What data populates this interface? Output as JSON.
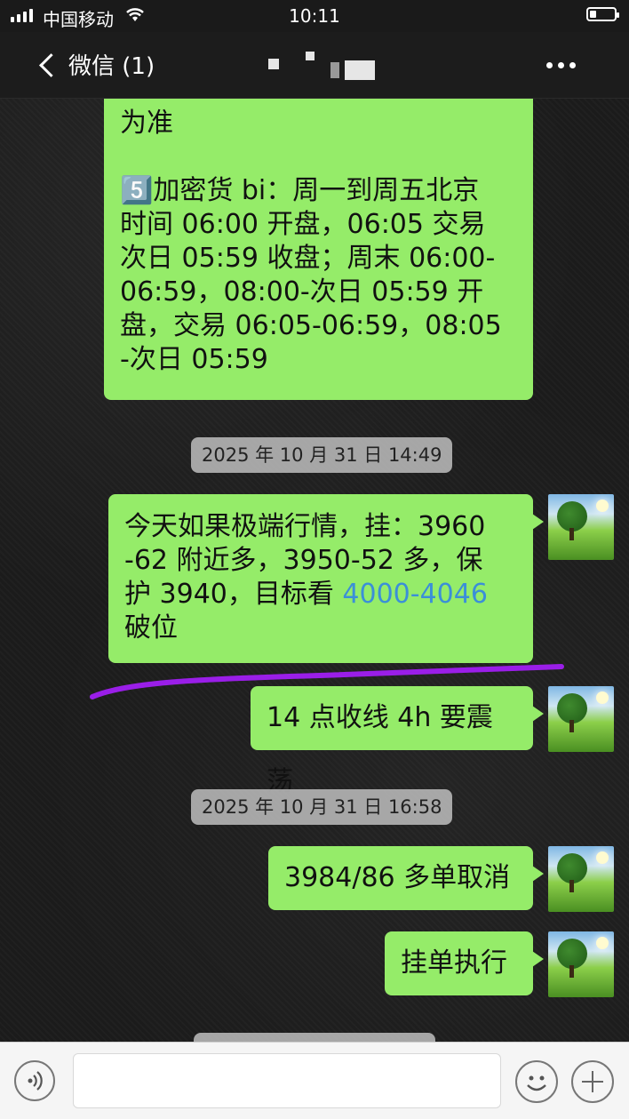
{
  "status_bar": {
    "carrier": "中国移动",
    "time": "10:11"
  },
  "header": {
    "back_label": "微信 (1)"
  },
  "messages": [
    {
      "type": "text",
      "lines": [
        "为准",
        "",
        "5️⃣加密货 bi：周一到周五北京",
        "时间 06:00 开盘，06:05 交易",
        "次日 05:59 收盘；周末 06:00-",
        "06:59，08:00-次日 05:59 开",
        "盘，交易 06:05-06:59，08:05",
        "-次日 05:59"
      ]
    },
    {
      "type": "timestamp",
      "text": "2025 年 10 月 31 日 14:49"
    },
    {
      "type": "text",
      "line1": "今天如果极端行情，挂：3960",
      "line2": "-62 附近多，3950-52 多，保",
      "line3_prefix": "护 3940，目标看 ",
      "line3_link": "4000-4046",
      "line4": "破位"
    },
    {
      "type": "text",
      "text": "14 点收线 4h 要震荡"
    },
    {
      "type": "timestamp",
      "text": "2025 年 10 月 31 日 16:58"
    },
    {
      "type": "text",
      "text": "3984/86 多单取消"
    },
    {
      "type": "text",
      "text": "挂单执行"
    }
  ],
  "colors": {
    "bubble": "#95ec69",
    "link": "#3b8fd8",
    "underline": "#9a1ee8"
  },
  "icons": [
    "back-chevron-icon",
    "more-icon",
    "voice-icon",
    "emoji-icon",
    "plus-icon",
    "wifi-icon",
    "battery-icon"
  ]
}
